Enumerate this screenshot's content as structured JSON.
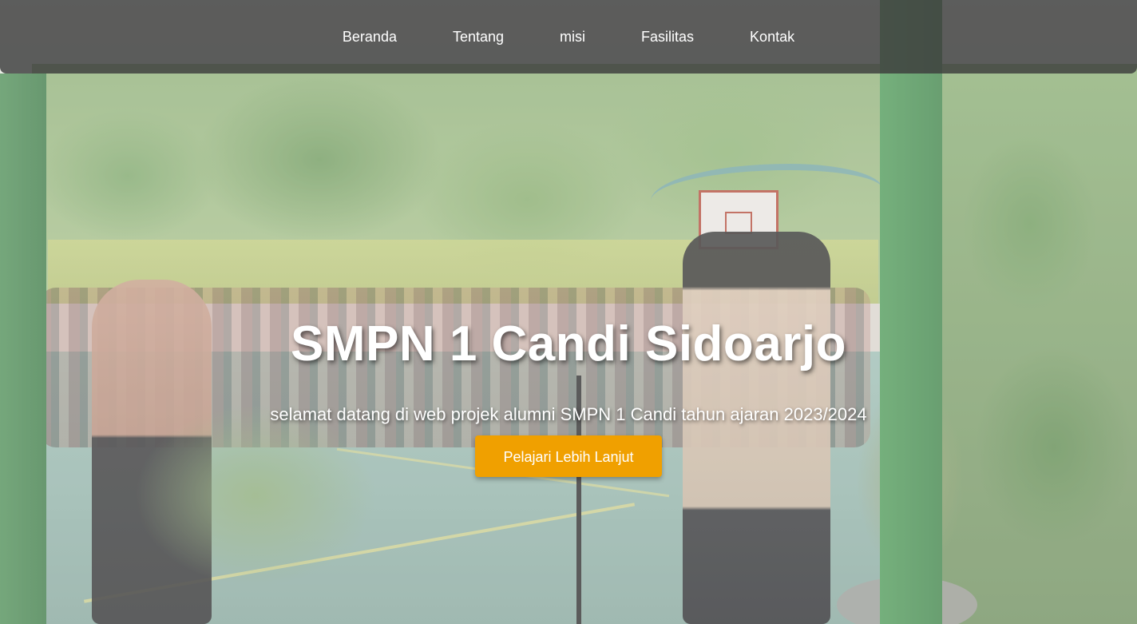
{
  "nav": {
    "items": [
      {
        "label": "Beranda"
      },
      {
        "label": "Tentang"
      },
      {
        "label": "misi"
      },
      {
        "label": "Fasilitas"
      },
      {
        "label": "Kontak"
      }
    ]
  },
  "hero": {
    "title": "SMPN 1 Candi Sidoarjo",
    "subtitle": "selamat datang di web projek alumni SMPN 1 Candi tahun ajaran 2023/2024",
    "cta_label": "Pelajari Lebih Lanjut",
    "background_image": "school-ceremony-photo"
  },
  "colors": {
    "nav_bg": "#3c3c3c",
    "cta_bg": "#f0a000",
    "text": "#ffffff"
  }
}
